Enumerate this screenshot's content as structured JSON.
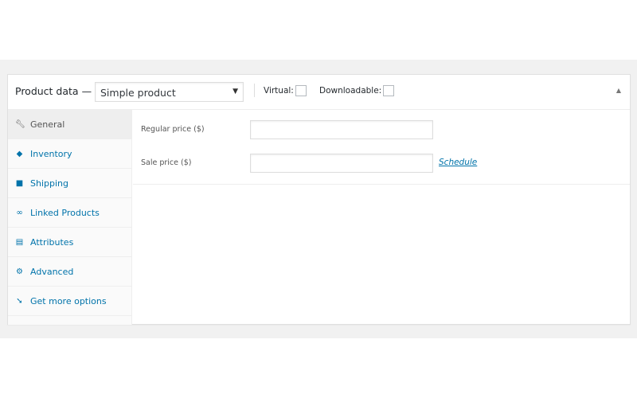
{
  "header": {
    "title": "Product data —",
    "product_type": "Simple product",
    "virtual_label": "Virtual:",
    "downloadable_label": "Downloadable:",
    "virtual_checked": false,
    "downloadable_checked": false
  },
  "tabs": [
    {
      "label": "General",
      "icon": "wrench-icon",
      "active": true
    },
    {
      "label": "Inventory",
      "icon": "tag-icon"
    },
    {
      "label": "Shipping",
      "icon": "truck-icon"
    },
    {
      "label": "Linked Products",
      "icon": "link-icon"
    },
    {
      "label": "Attributes",
      "icon": "list-icon"
    },
    {
      "label": "Advanced",
      "icon": "gear-icon"
    },
    {
      "label": "Get more options",
      "icon": "plugin-icon"
    }
  ],
  "general": {
    "regular_price_label": "Regular price ($)",
    "regular_price_value": "",
    "sale_price_label": "Sale price ($)",
    "sale_price_value": "",
    "schedule_link": "Schedule"
  },
  "colors": {
    "link": "#0073aa",
    "background": "#f1f1f1"
  }
}
